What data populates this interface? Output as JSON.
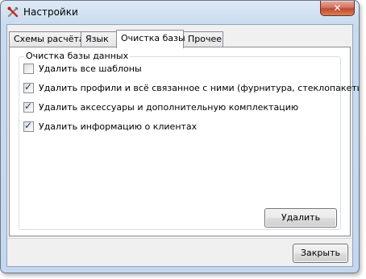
{
  "window": {
    "title": "Настройки",
    "close_glyph": "✕"
  },
  "tabs": [
    {
      "label": "Схемы расчёта",
      "active": false
    },
    {
      "label": "Язык",
      "active": false
    },
    {
      "label": "Очистка базы",
      "active": true
    },
    {
      "label": "Прочее",
      "active": false
    }
  ],
  "group": {
    "title": "Очистка базы данных",
    "options": [
      {
        "label": "Удалить все шаблоны",
        "checked": false
      },
      {
        "label": "Удалить профили и всё связанное с ними (фурнитура, стеклопакеты)",
        "checked": true
      },
      {
        "label": "Удалить аксессуары и дополнительную комплектацию",
        "checked": true
      },
      {
        "label": "Удалить информацию о клиентах",
        "checked": true
      }
    ],
    "delete_button": "Удалить"
  },
  "footer": {
    "close_button": "Закрыть"
  }
}
